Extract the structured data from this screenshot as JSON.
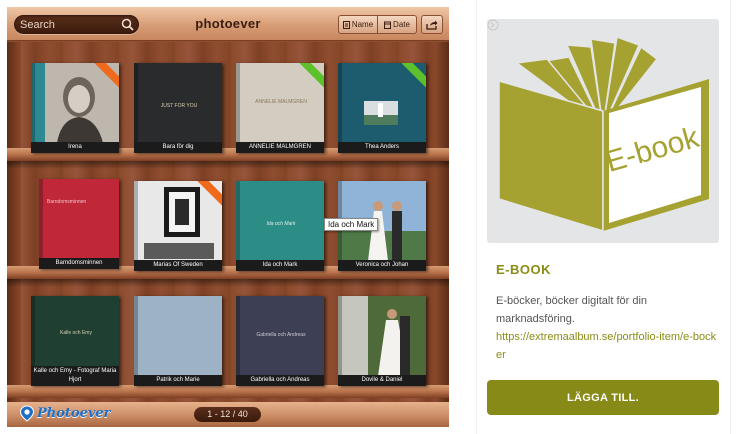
{
  "app": {
    "title": "photoever",
    "search": {
      "placeholder": "Search"
    },
    "sort": {
      "name_label": "Name",
      "date_label": "Date"
    },
    "pager": "1 - 12 / 40",
    "brand": "Photoever",
    "tooltip": "Ida och Mark"
  },
  "books": [
    {
      "label": "Irena",
      "cover": "#2d8a93",
      "ribbon": "orange"
    },
    {
      "label": "Bara för dig",
      "cover": "#2a2b2c",
      "cover_text": "JUST FOR YOU"
    },
    {
      "label": "ANNELIE MALMGREN",
      "cover": "#d3ccc1",
      "ribbon": "green",
      "cover_text": "ANNELIE MALMGREN"
    },
    {
      "label": "Thea Anders",
      "cover": "#1d5b6f",
      "ribbon": "green"
    },
    {
      "label": "Barndomsminnen",
      "cover": "#c0283a",
      "cover_text": "Barndomsminnen"
    },
    {
      "label": "Marias Of Sweden",
      "cover": "#e8e8e8",
      "ribbon": "orange"
    },
    {
      "label": "Ida och Mark",
      "cover": "#2c8c86",
      "cover_text": "Ida och Mark"
    },
    {
      "label": "Veronica och Johan",
      "cover": "#6e9ac4"
    },
    {
      "label": "Kalle och Emy - Fotograf Maria Hjort",
      "cover": "#1f3f33",
      "cover_text": "Kalle och Emy"
    },
    {
      "label": "Patrik och Marie",
      "cover": "#9eb2c5"
    },
    {
      "label": "Gabriella och Andreas",
      "cover": "#3d3f55",
      "cover_text": "Gabriella och Andreas"
    },
    {
      "label": "Dovile & Daniel",
      "cover": "#c5c6be"
    }
  ],
  "card": {
    "image_text": "E-book",
    "title": "E-BOOK",
    "description": "E-böcker, böcker digitalt för din marknadsföring.",
    "link": "https://extremaalbum.se/portfolio-item/e-bocker",
    "button": "LÄGGA TILL."
  },
  "colors": {
    "accent": "#878a16",
    "wood": "#8e4f2f",
    "ribbon_orange": "#f06a1e",
    "ribbon_green": "#5cc12a"
  }
}
